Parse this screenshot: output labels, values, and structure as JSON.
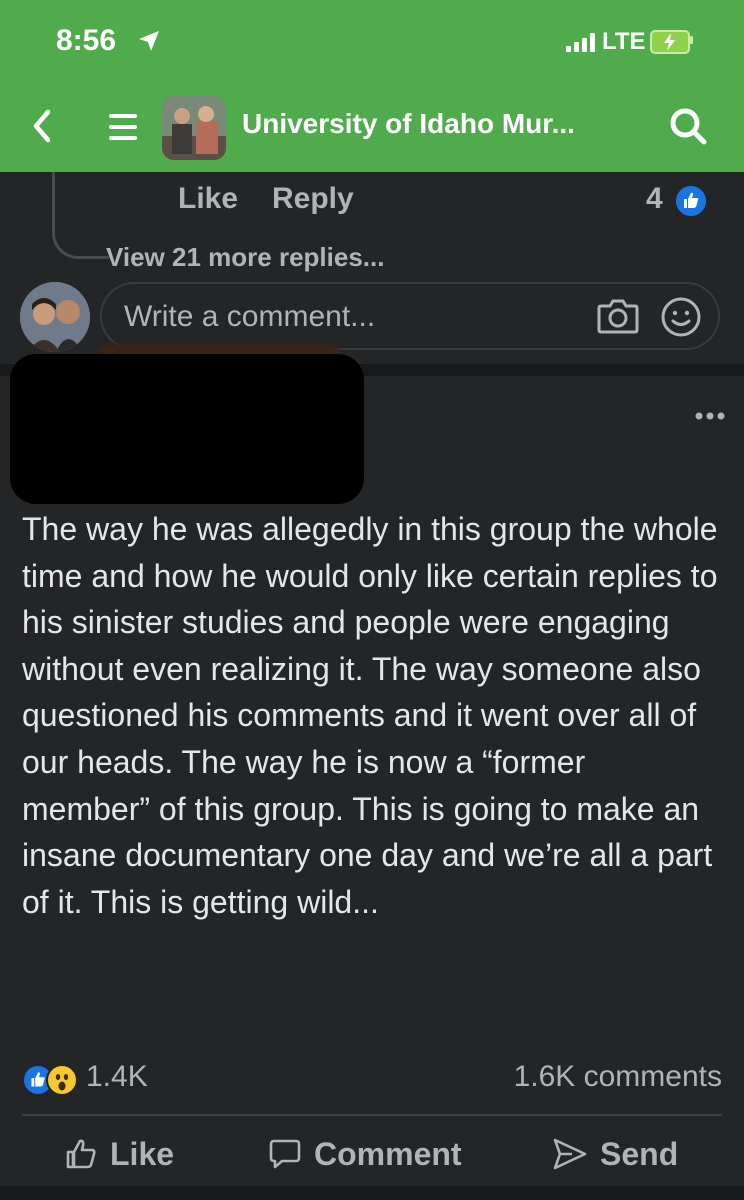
{
  "status_bar": {
    "time": "8:56",
    "network": "LTE",
    "icons": [
      "location-arrow-icon",
      "signal-bars-icon",
      "battery-charging-icon"
    ]
  },
  "header": {
    "title": "University of Idaho Mur...",
    "icons": [
      "back-chevron-icon",
      "menu-icon",
      "search-icon"
    ],
    "accent_color": "#4fab4b"
  },
  "previous_comment": {
    "like_label": "Like",
    "reply_label": "Reply",
    "reaction_count": "4",
    "view_more_label": "View 21 more replies..."
  },
  "composer": {
    "placeholder": "Write a comment...",
    "icons": [
      "camera-icon",
      "emoji-icon"
    ]
  },
  "post": {
    "body": "The way he was allegedly in this group the whole time and how he would only like certain replies to his sinister studies and people were engaging without even realizing it. The way someone also questioned his comments and it went over all of our heads. The way he is now a “former member” of this group. This is going to make an insane documentary one day and we’re all a part of it. This is getting wild...",
    "reaction_total": "1.4K",
    "comment_count": "1.6K comments",
    "actions": {
      "like": "Like",
      "comment": "Comment",
      "send": "Send"
    }
  },
  "colors": {
    "background": "#242526",
    "text": "#e4e6eb",
    "secondary_text": "#b0b3b8",
    "like_blue": "#1b74e4"
  }
}
